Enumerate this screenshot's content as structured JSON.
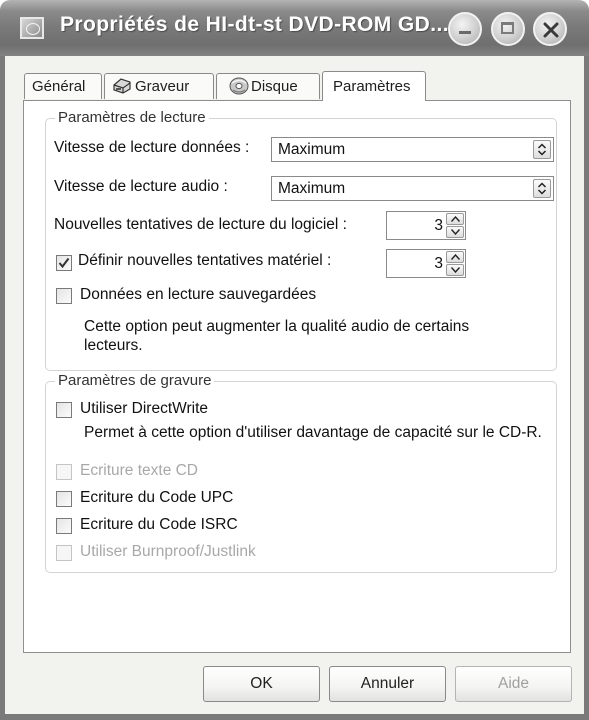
{
  "window": {
    "title": "Propriétés de HI-dt-st DVD-ROM GD..."
  },
  "tabs": [
    {
      "label": "Général",
      "icon": "none",
      "active": false
    },
    {
      "label": "Graveur",
      "icon": "burner-icon",
      "active": false
    },
    {
      "label": "Disque",
      "icon": "disc-icon",
      "active": false
    },
    {
      "label": "Paramètres",
      "icon": "none",
      "active": true
    }
  ],
  "reading": {
    "group_label": "Paramètres de lecture",
    "data_speed_label": "Vitesse de lecture données :",
    "data_speed_value": "Maximum",
    "audio_speed_label": "Vitesse de lecture audio :",
    "audio_speed_value": "Maximum",
    "software_retries_label": "Nouvelles tentatives de lecture du logiciel :",
    "software_retries_value": "3",
    "hardware_retries_label": "Définir nouvelles tentatives matériel :",
    "hardware_retries_checked": true,
    "hardware_retries_value": "3",
    "buffered_reading_label": "Données en lecture sauvegardées",
    "buffered_reading_checked": false,
    "buffered_reading_desc": "Cette option peut augmenter la qualité audio de certains lecteurs."
  },
  "burning": {
    "group_label": "Paramètres de gravure",
    "directwrite_label": "Utiliser DirectWrite",
    "directwrite_checked": false,
    "directwrite_desc": "Permet à cette option d'utiliser davantage de capacité sur le CD-R.",
    "cd_text_label": "Ecriture texte CD",
    "cd_text_enabled": false,
    "upc_label": "Ecriture du Code UPC",
    "upc_checked": false,
    "isrc_label": "Ecriture du Code ISRC",
    "isrc_checked": false,
    "burnproof_label": "Utiliser Burnproof/Justlink",
    "burnproof_enabled": false
  },
  "buttons": {
    "ok": "OK",
    "cancel": "Annuler",
    "help": "Aide",
    "help_enabled": false
  }
}
